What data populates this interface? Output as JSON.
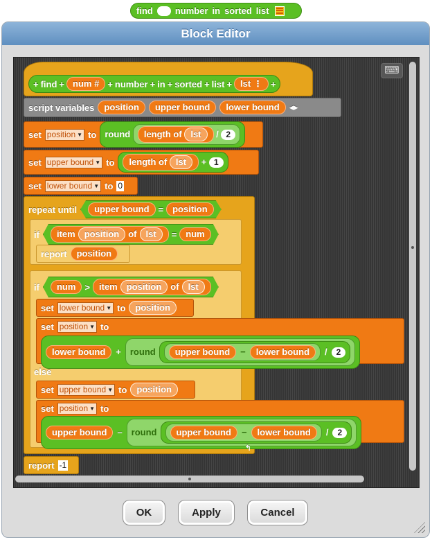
{
  "preview": {
    "w1": "find",
    "w2": "number",
    "w3": "in",
    "w4": "sorted",
    "w5": "list"
  },
  "dialog": {
    "title": "Block Editor"
  },
  "hat": {
    "plus": "+",
    "find": "find",
    "param_num": "num #",
    "number": "number",
    "in": "in",
    "sorted": "sorted",
    "list": "list",
    "param_lst": "lst ⋮"
  },
  "script_vars": {
    "label": "script variables",
    "v1": "position",
    "v2": "upper bound",
    "v3": "lower bound",
    "arrows": "◂▸"
  },
  "vars": {
    "position": "position",
    "upper": "upper bound",
    "lower": "lower bound",
    "num": "num",
    "lst": "lst"
  },
  "words": {
    "set": "set",
    "to": "to",
    "round": "round",
    "length_of": "length of",
    "div": "/",
    "plus": "+",
    "minus": "−",
    "repeat_until": "repeat until",
    "eq": "=",
    "if": "if",
    "item": "item",
    "of": "of",
    "report": "report",
    "gt": ">",
    "else": "else",
    "minus_dash": "–"
  },
  "values": {
    "two": "2",
    "one": "1",
    "zero": "0",
    "neg_one": "-1"
  },
  "buttons": {
    "ok": "OK",
    "apply": "Apply",
    "cancel": "Cancel"
  }
}
